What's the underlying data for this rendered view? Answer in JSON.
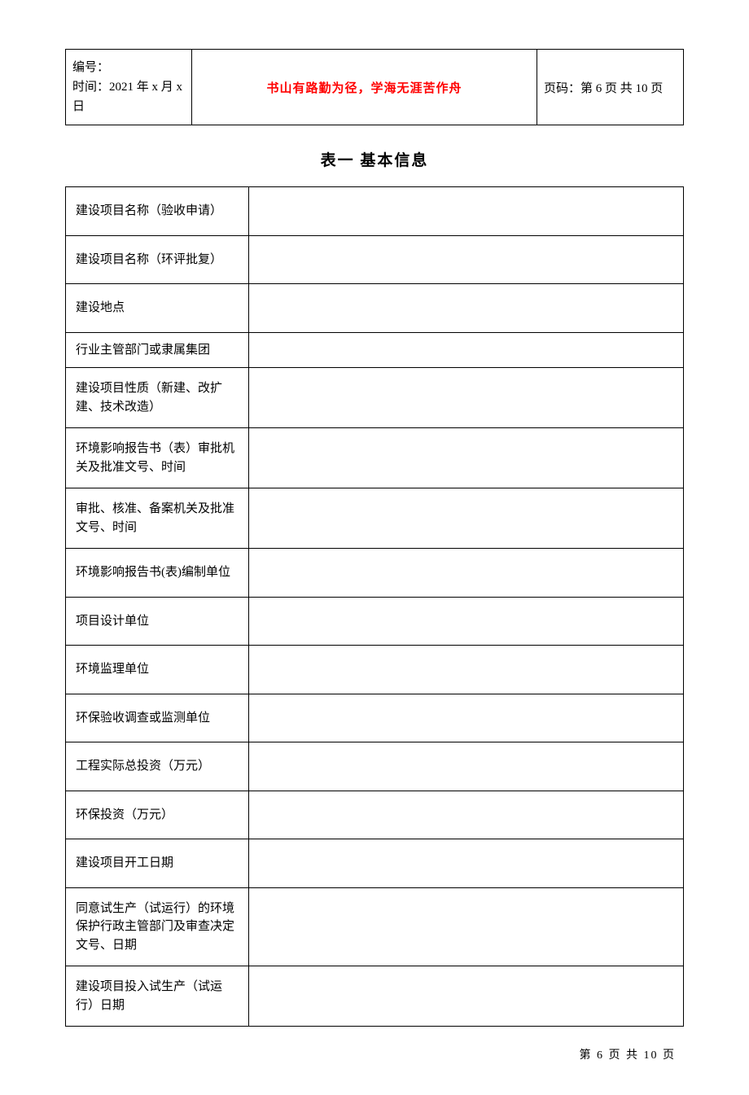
{
  "header": {
    "serial_label": "编号：",
    "time_label": "时间：2021 年 x 月 x 日",
    "motto": "书山有路勤为径，学海无涯苦作舟",
    "page_code": "页码：第 6 页 共 10 页"
  },
  "title": "表一  基本信息",
  "rows": [
    {
      "label": "建设项目名称（验收申请）",
      "value": ""
    },
    {
      "label": "建设项目名称（环评批复）",
      "value": ""
    },
    {
      "label": "建设地点",
      "value": ""
    },
    {
      "label": "行业主管部门或隶属集团",
      "value": ""
    },
    {
      "label": "建设项目性质（新建、改扩建、技术改造）",
      "value": ""
    },
    {
      "label": "环境影响报告书（表）审批机关及批准文号、时间",
      "value": ""
    },
    {
      "label": "审批、核准、备案机关及批准文号、时间",
      "value": ""
    },
    {
      "label": "环境影响报告书(表)编制单位",
      "value": ""
    },
    {
      "label": "项目设计单位",
      "value": ""
    },
    {
      "label": "环境监理单位",
      "value": ""
    },
    {
      "label": "环保验收调查或监测单位",
      "value": ""
    },
    {
      "label": "工程实际总投资（万元）",
      "value": ""
    },
    {
      "label": "环保投资（万元）",
      "value": ""
    },
    {
      "label": "建设项目开工日期",
      "value": ""
    },
    {
      "label": "同意试生产（试运行）的环境保护行政主管部门及审查决定文号、日期",
      "value": ""
    },
    {
      "label": "建设项目投入试生产（试运行）日期",
      "value": ""
    }
  ],
  "footer": "第 6 页 共 10 页"
}
